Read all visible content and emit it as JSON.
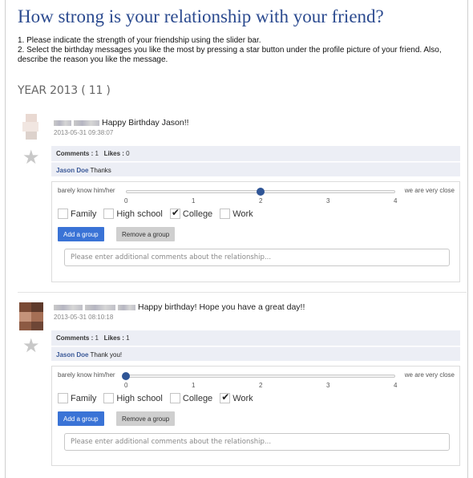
{
  "page": {
    "title": "How strong is your relationship with your friend?",
    "instruction_1": "1. Please indicate the strength of your friendship using the slider bar.",
    "instruction_2": "2. Select the birthday messages you like the most by pressing a star button under the profile picture of your friend. Also, describe the reason you like the message.",
    "year_label": "YEAR 2013 ( 11 )"
  },
  "slider": {
    "left_label": "barely know him/her",
    "right_label": "we are very close",
    "ticks": [
      "0",
      "1",
      "2",
      "3",
      "4"
    ],
    "min": 0,
    "max": 4
  },
  "groups": [
    "Family",
    "High school",
    "College",
    "Work"
  ],
  "buttons": {
    "add": "Add a group",
    "remove": "Remove a group"
  },
  "comment_placeholder": "Please enter additional comments about the relationship...",
  "posts": [
    {
      "message": "Happy Birthday Jason!!",
      "timestamp": "2013-05-31 09:38:07",
      "comments_label": "Comments :",
      "comments_count": "1",
      "likes_label": "Likes :",
      "likes_count": "0",
      "reply_author": "Jason Doe",
      "reply_text": "Thanks",
      "slider_value": 2,
      "groups_checked": [
        false,
        false,
        true,
        false
      ]
    },
    {
      "message": "Happy birthday! Hope you have a great day!!",
      "timestamp": "2013-05-31 08:10:18",
      "comments_label": "Comments :",
      "comments_count": "1",
      "likes_label": "Likes :",
      "likes_count": "1",
      "reply_author": "Jason Doe",
      "reply_text": "Thank you!",
      "slider_value": 0,
      "groups_checked": [
        false,
        false,
        false,
        true
      ]
    }
  ],
  "colors": {
    "title": "#2b4a8f",
    "knob": "#2f5596",
    "add_button": "#3a73d6",
    "comments_bg": "#eceef5"
  }
}
